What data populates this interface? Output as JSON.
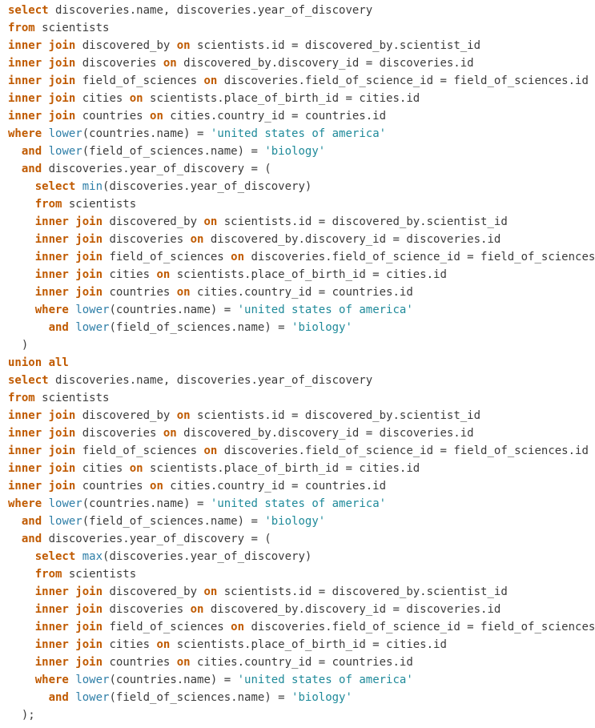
{
  "code_lines": [
    [
      [
        "kw",
        "select"
      ],
      [
        "tx",
        " discoveries.name, discoveries.year_of_discovery"
      ]
    ],
    [
      [
        "kw",
        "from"
      ],
      [
        "tx",
        " scientists"
      ]
    ],
    [
      [
        "kw",
        "inner join"
      ],
      [
        "tx",
        " discovered_by "
      ],
      [
        "kw",
        "on"
      ],
      [
        "tx",
        " scientists.id = discovered_by.scientist_id"
      ]
    ],
    [
      [
        "kw",
        "inner join"
      ],
      [
        "tx",
        " discoveries "
      ],
      [
        "kw",
        "on"
      ],
      [
        "tx",
        " discovered_by.discovery_id = discoveries.id"
      ]
    ],
    [
      [
        "kw",
        "inner join"
      ],
      [
        "tx",
        " field_of_sciences "
      ],
      [
        "kw",
        "on"
      ],
      [
        "tx",
        " discoveries.field_of_science_id = field_of_sciences.id"
      ]
    ],
    [
      [
        "kw",
        "inner join"
      ],
      [
        "tx",
        " cities "
      ],
      [
        "kw",
        "on"
      ],
      [
        "tx",
        " scientists.place_of_birth_id = cities.id"
      ]
    ],
    [
      [
        "kw",
        "inner join"
      ],
      [
        "tx",
        " countries "
      ],
      [
        "kw",
        "on"
      ],
      [
        "tx",
        " cities.country_id = countries.id"
      ]
    ],
    [
      [
        "kw",
        "where"
      ],
      [
        "tx",
        " "
      ],
      [
        "fn",
        "lower"
      ],
      [
        "tx",
        "(countries.name) = "
      ],
      [
        "str",
        "'united states of america'"
      ]
    ],
    [
      [
        "tx",
        "  "
      ],
      [
        "kw",
        "and"
      ],
      [
        "tx",
        " "
      ],
      [
        "fn",
        "lower"
      ],
      [
        "tx",
        "(field_of_sciences.name) = "
      ],
      [
        "str",
        "'biology'"
      ]
    ],
    [
      [
        "tx",
        "  "
      ],
      [
        "kw",
        "and"
      ],
      [
        "tx",
        " discoveries.year_of_discovery = ("
      ]
    ],
    [
      [
        "tx",
        "    "
      ],
      [
        "kw",
        "select"
      ],
      [
        "tx",
        " "
      ],
      [
        "fn",
        "min"
      ],
      [
        "tx",
        "(discoveries.year_of_discovery)"
      ]
    ],
    [
      [
        "tx",
        "    "
      ],
      [
        "kw",
        "from"
      ],
      [
        "tx",
        " scientists"
      ]
    ],
    [
      [
        "tx",
        "    "
      ],
      [
        "kw",
        "inner join"
      ],
      [
        "tx",
        " discovered_by "
      ],
      [
        "kw",
        "on"
      ],
      [
        "tx",
        " scientists.id = discovered_by.scientist_id"
      ]
    ],
    [
      [
        "tx",
        "    "
      ],
      [
        "kw",
        "inner join"
      ],
      [
        "tx",
        " discoveries "
      ],
      [
        "kw",
        "on"
      ],
      [
        "tx",
        " discovered_by.discovery_id = discoveries.id"
      ]
    ],
    [
      [
        "tx",
        "    "
      ],
      [
        "kw",
        "inner join"
      ],
      [
        "tx",
        " field_of_sciences "
      ],
      [
        "kw",
        "on"
      ],
      [
        "tx",
        " discoveries.field_of_science_id = field_of_sciences.id"
      ]
    ],
    [
      [
        "tx",
        "    "
      ],
      [
        "kw",
        "inner join"
      ],
      [
        "tx",
        " cities "
      ],
      [
        "kw",
        "on"
      ],
      [
        "tx",
        " scientists.place_of_birth_id = cities.id"
      ]
    ],
    [
      [
        "tx",
        "    "
      ],
      [
        "kw",
        "inner join"
      ],
      [
        "tx",
        " countries "
      ],
      [
        "kw",
        "on"
      ],
      [
        "tx",
        " cities.country_id = countries.id"
      ]
    ],
    [
      [
        "tx",
        "    "
      ],
      [
        "kw",
        "where"
      ],
      [
        "tx",
        " "
      ],
      [
        "fn",
        "lower"
      ],
      [
        "tx",
        "(countries.name) = "
      ],
      [
        "str",
        "'united states of america'"
      ]
    ],
    [
      [
        "tx",
        "      "
      ],
      [
        "kw",
        "and"
      ],
      [
        "tx",
        " "
      ],
      [
        "fn",
        "lower"
      ],
      [
        "tx",
        "(field_of_sciences.name) = "
      ],
      [
        "str",
        "'biology'"
      ]
    ],
    [
      [
        "tx",
        "  )"
      ]
    ],
    [
      [
        "kw",
        "union all"
      ]
    ],
    [
      [
        "kw",
        "select"
      ],
      [
        "tx",
        " discoveries.name, discoveries.year_of_discovery"
      ]
    ],
    [
      [
        "kw",
        "from"
      ],
      [
        "tx",
        " scientists"
      ]
    ],
    [
      [
        "kw",
        "inner join"
      ],
      [
        "tx",
        " discovered_by "
      ],
      [
        "kw",
        "on"
      ],
      [
        "tx",
        " scientists.id = discovered_by.scientist_id"
      ]
    ],
    [
      [
        "kw",
        "inner join"
      ],
      [
        "tx",
        " discoveries "
      ],
      [
        "kw",
        "on"
      ],
      [
        "tx",
        " discovered_by.discovery_id = discoveries.id"
      ]
    ],
    [
      [
        "kw",
        "inner join"
      ],
      [
        "tx",
        " field_of_sciences "
      ],
      [
        "kw",
        "on"
      ],
      [
        "tx",
        " discoveries.field_of_science_id = field_of_sciences.id"
      ]
    ],
    [
      [
        "kw",
        "inner join"
      ],
      [
        "tx",
        " cities "
      ],
      [
        "kw",
        "on"
      ],
      [
        "tx",
        " scientists.place_of_birth_id = cities.id"
      ]
    ],
    [
      [
        "kw",
        "inner join"
      ],
      [
        "tx",
        " countries "
      ],
      [
        "kw",
        "on"
      ],
      [
        "tx",
        " cities.country_id = countries.id"
      ]
    ],
    [
      [
        "kw",
        "where"
      ],
      [
        "tx",
        " "
      ],
      [
        "fn",
        "lower"
      ],
      [
        "tx",
        "(countries.name) = "
      ],
      [
        "str",
        "'united states of america'"
      ]
    ],
    [
      [
        "tx",
        "  "
      ],
      [
        "kw",
        "and"
      ],
      [
        "tx",
        " "
      ],
      [
        "fn",
        "lower"
      ],
      [
        "tx",
        "(field_of_sciences.name) = "
      ],
      [
        "str",
        "'biology'"
      ]
    ],
    [
      [
        "tx",
        "  "
      ],
      [
        "kw",
        "and"
      ],
      [
        "tx",
        " discoveries.year_of_discovery = ("
      ]
    ],
    [
      [
        "tx",
        "    "
      ],
      [
        "kw",
        "select"
      ],
      [
        "tx",
        " "
      ],
      [
        "fn",
        "max"
      ],
      [
        "tx",
        "(discoveries.year_of_discovery)"
      ]
    ],
    [
      [
        "tx",
        "    "
      ],
      [
        "kw",
        "from"
      ],
      [
        "tx",
        " scientists"
      ]
    ],
    [
      [
        "tx",
        "    "
      ],
      [
        "kw",
        "inner join"
      ],
      [
        "tx",
        " discovered_by "
      ],
      [
        "kw",
        "on"
      ],
      [
        "tx",
        " scientists.id = discovered_by.scientist_id"
      ]
    ],
    [
      [
        "tx",
        "    "
      ],
      [
        "kw",
        "inner join"
      ],
      [
        "tx",
        " discoveries "
      ],
      [
        "kw",
        "on"
      ],
      [
        "tx",
        " discovered_by.discovery_id = discoveries.id"
      ]
    ],
    [
      [
        "tx",
        "    "
      ],
      [
        "kw",
        "inner join"
      ],
      [
        "tx",
        " field_of_sciences "
      ],
      [
        "kw",
        "on"
      ],
      [
        "tx",
        " discoveries.field_of_science_id = field_of_sciences.id"
      ]
    ],
    [
      [
        "tx",
        "    "
      ],
      [
        "kw",
        "inner join"
      ],
      [
        "tx",
        " cities "
      ],
      [
        "kw",
        "on"
      ],
      [
        "tx",
        " scientists.place_of_birth_id = cities.id"
      ]
    ],
    [
      [
        "tx",
        "    "
      ],
      [
        "kw",
        "inner join"
      ],
      [
        "tx",
        " countries "
      ],
      [
        "kw",
        "on"
      ],
      [
        "tx",
        " cities.country_id = countries.id"
      ]
    ],
    [
      [
        "tx",
        "    "
      ],
      [
        "kw",
        "where"
      ],
      [
        "tx",
        " "
      ],
      [
        "fn",
        "lower"
      ],
      [
        "tx",
        "(countries.name) = "
      ],
      [
        "str",
        "'united states of america'"
      ]
    ],
    [
      [
        "tx",
        "      "
      ],
      [
        "kw",
        "and"
      ],
      [
        "tx",
        " "
      ],
      [
        "fn",
        "lower"
      ],
      [
        "tx",
        "(field_of_sciences.name) = "
      ],
      [
        "str",
        "'biology'"
      ]
    ],
    [
      [
        "tx",
        "  );"
      ]
    ]
  ]
}
